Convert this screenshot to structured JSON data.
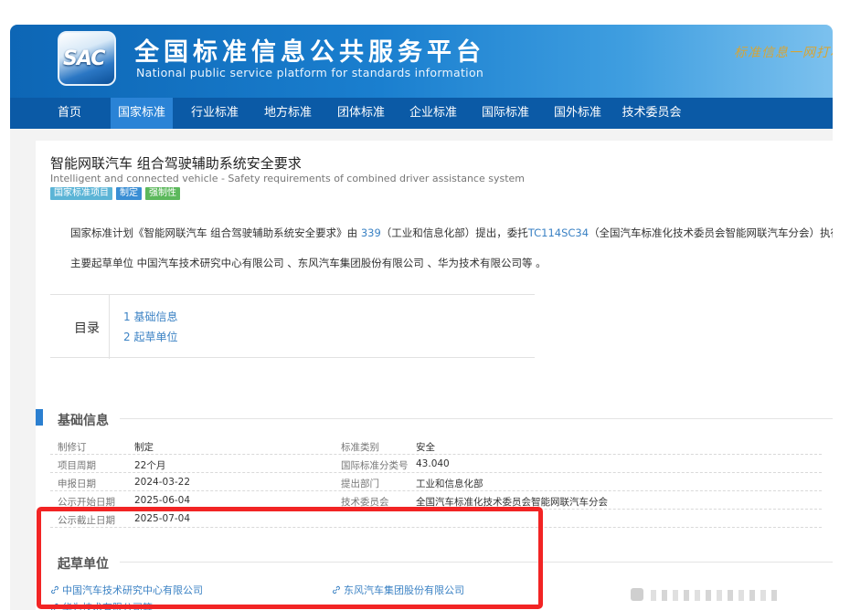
{
  "header": {
    "logo_text": "SAC",
    "title": "全国标准信息公共服务平台",
    "subtitle": "National public service platform  for standards information",
    "slogan": "标准信息一网打尽"
  },
  "nav": {
    "items": [
      "首页",
      "国家标准",
      "行业标准",
      "地方标准",
      "团体标准",
      "企业标准",
      "国际标准",
      "国外标准",
      "技术委员会"
    ],
    "active_index": 1
  },
  "document": {
    "title": "智能网联汽车 组合驾驶辅助系统安全要求",
    "english_title": "Intelligent and connected vehicle - Safety requirements of combined driver assistance system",
    "badges": [
      "国家标准项目",
      "制定",
      "强制性"
    ]
  },
  "summary": {
    "line1_prefix": "国家标准计划《智能网联汽车 组合驾驶辅助系统安全要求》由 ",
    "line1_link1": "339",
    "line1_middle": "（工业和信息化部）提出，委托",
    "line1_link2": "TC114SC34",
    "line1_suffix": "（全国汽车标准化技术委员会智能网联汽车分会）执行 。",
    "line2": "主要起草单位 中国汽车技术研究中心有限公司 、东风汽车集团股份有限公司 、华为技术有限公司等 。"
  },
  "toc": {
    "label": "目录",
    "items": [
      "1  基础信息",
      "2  起草单位"
    ]
  },
  "basic_info": {
    "heading": "基础信息",
    "rows": [
      {
        "l1": "制修订",
        "v1": "制定",
        "l2": "标准类别",
        "v2": "安全"
      },
      {
        "l1": "项目周期",
        "v1": "22个月",
        "l2": "国际标准分类号",
        "v2": "43.040"
      },
      {
        "l1": "申报日期",
        "v1": "2024-03-22",
        "l2": "提出部门",
        "v2": "工业和信息化部"
      },
      {
        "l1": "公示开始日期",
        "v1": "2025-06-04",
        "l2": "技术委员会",
        "v2": "全国汽车标准化技术委员会智能网联汽车分会"
      },
      {
        "l1": "公示截止日期",
        "v1": "2025-07-04",
        "l2": "",
        "v2": ""
      }
    ]
  },
  "drafters": {
    "heading": "起草单位",
    "items": [
      "中国汽车技术研究中心有限公司",
      "东风汽车集团股份有限公司",
      "华为技术有限公司等"
    ]
  },
  "colors": {
    "brand_blue": "#0b5aa6",
    "active_nav": "#2a83d6",
    "link": "#3b82c4",
    "highlight_red": "#f22424"
  }
}
